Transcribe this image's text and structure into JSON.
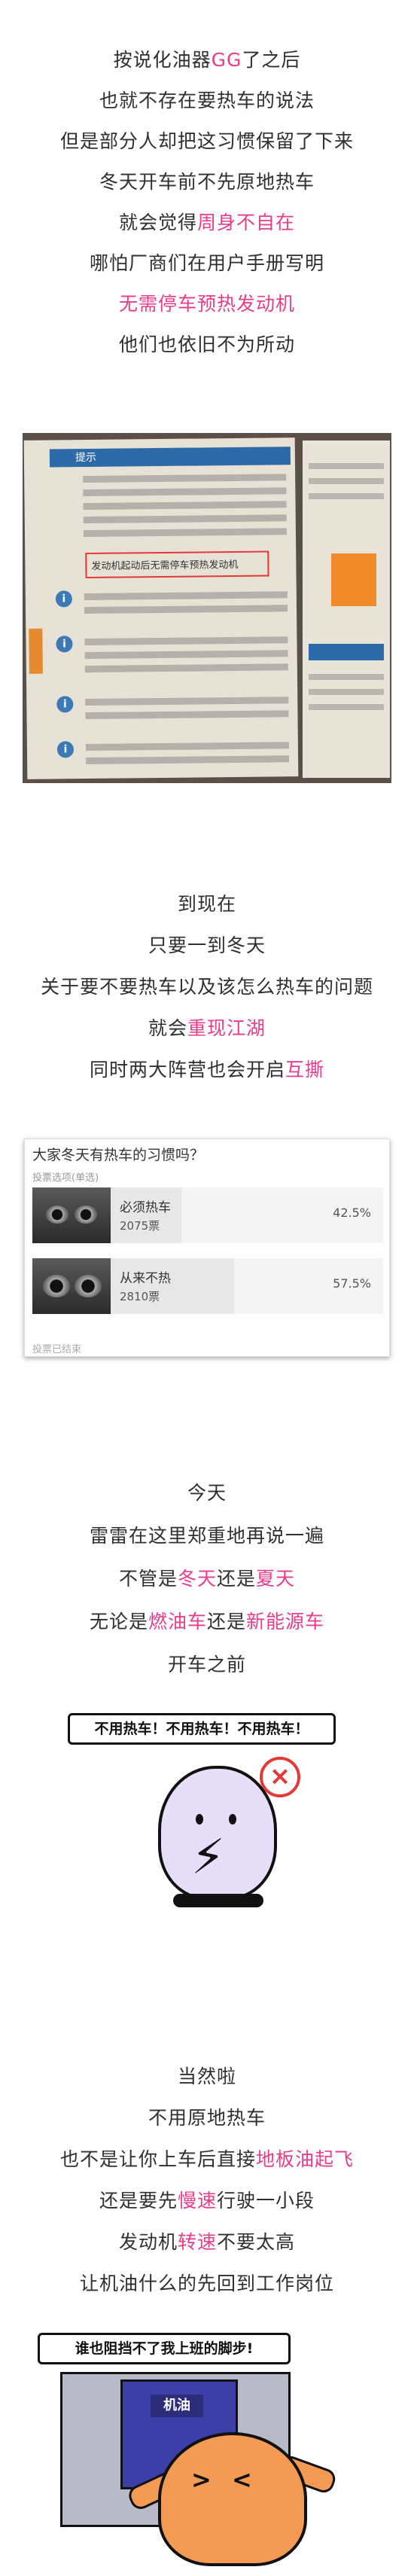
{
  "intro_lines": [
    {
      "parts": [
        {
          "t": "按说化油器"
        },
        {
          "t": "GG",
          "pink": true
        },
        {
          "t": "了之后"
        }
      ]
    },
    {
      "parts": [
        {
          "t": "也就不存在要热车的说法"
        }
      ]
    },
    {
      "parts": [
        {
          "t": "但是部分人却把这习惯保留了下来"
        }
      ]
    },
    {
      "parts": [
        {
          "t": "冬天开车前不先原地热车"
        }
      ]
    },
    {
      "parts": [
        {
          "t": "就会觉得"
        },
        {
          "t": "周身不自在",
          "pink": true
        }
      ]
    },
    {
      "parts": [
        {
          "t": "哪怕厂商们在用户手册写明"
        }
      ]
    },
    {
      "parts": [
        {
          "t": "无需停车预热发动机",
          "pink": true
        }
      ]
    },
    {
      "parts": [
        {
          "t": "他们也依旧不为所动"
        }
      ]
    }
  ],
  "manual_photo": {
    "tip_title": "提示",
    "highlight_text": "发动机起动后无需停车预热发动机"
  },
  "mid_lines": [
    {
      "parts": [
        {
          "t": "到现在"
        }
      ]
    },
    {
      "parts": [
        {
          "t": "只要一到冬天"
        }
      ]
    },
    {
      "parts": [
        {
          "t": "关于要不要热车以及该怎么热车的问题"
        }
      ]
    },
    {
      "parts": [
        {
          "t": "就会"
        },
        {
          "t": "重现江湖",
          "pink": true
        }
      ]
    },
    {
      "parts": [
        {
          "t": "同时两大阵营也会开启"
        },
        {
          "t": "互撕",
          "pink": true
        }
      ]
    }
  ],
  "poll": {
    "question": "大家冬天有热车的习惯吗？",
    "hint": "投票选项(单选)",
    "options": [
      {
        "label": "必须热车",
        "votes": "2075票",
        "percent": "42.5%",
        "fraction": 0.425
      },
      {
        "label": "从来不热",
        "votes": "2810票",
        "percent": "57.5%",
        "fraction": 0.575
      }
    ],
    "footer": "投票已结束"
  },
  "today_lines": [
    {
      "parts": [
        {
          "t": "今天"
        }
      ]
    },
    {
      "parts": [
        {
          "t": "雷雷在这里郑重地再说一遍"
        }
      ]
    },
    {
      "parts": [
        {
          "t": "不管是"
        },
        {
          "t": "冬天",
          "pink": true
        },
        {
          "t": "还是"
        },
        {
          "t": "夏天",
          "pink": true
        }
      ]
    },
    {
      "parts": [
        {
          "t": "无论是"
        },
        {
          "t": "燃油车",
          "pink": true
        },
        {
          "t": "还是"
        },
        {
          "t": "新能源车",
          "pink": true
        }
      ]
    },
    {
      "parts": [
        {
          "t": "开车之前"
        }
      ]
    }
  ],
  "mascot1": {
    "banner": "不用热车！不用热车！不用热车！"
  },
  "end_lines": [
    {
      "parts": [
        {
          "t": "当然啦"
        }
      ]
    },
    {
      "parts": [
        {
          "t": "不用原地热车"
        }
      ]
    },
    {
      "parts": [
        {
          "t": "也不是让你上车后直接"
        },
        {
          "t": "地板油起飞",
          "pink": true
        }
      ]
    },
    {
      "parts": [
        {
          "t": "还是要先"
        },
        {
          "t": "慢速",
          "pink": true
        },
        {
          "t": "行驶一小段"
        }
      ]
    },
    {
      "parts": [
        {
          "t": "发动机"
        },
        {
          "t": "转速",
          "pink": true
        },
        {
          "t": "不要太高"
        }
      ]
    },
    {
      "parts": [
        {
          "t": "让机油什么的先回到工作岗位"
        }
      ]
    }
  ],
  "mascot2": {
    "banner": "谁也阻挡不了我上班的脚步!",
    "sign": "机油"
  },
  "colors": {
    "accent": "#e83d8c",
    "text": "#2f2f2f"
  }
}
